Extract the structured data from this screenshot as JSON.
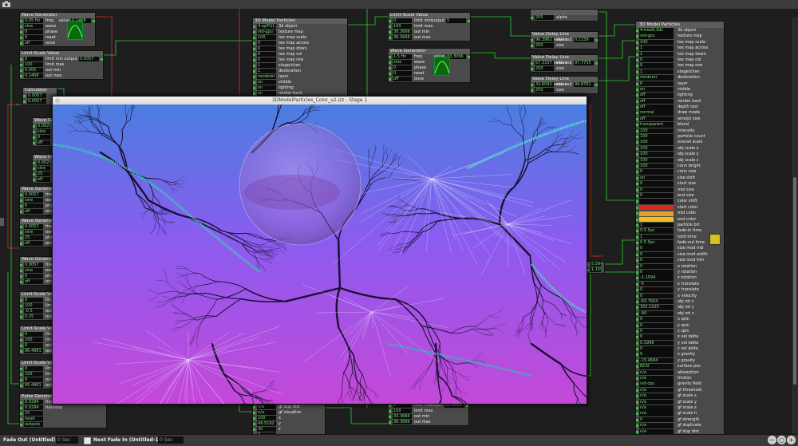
{
  "stage": {
    "title": "3DModelParticles_Color_v2.izz : Stage 1",
    "background_top": "#4a7ee0",
    "background_mid": "#8a5cf0",
    "background_bottom": "#c548d8"
  },
  "actors": {
    "wave1": {
      "title": "Wave Generator",
      "inputs": [
        "0.05 Hz",
        "sine",
        "0",
        "0",
        "off"
      ],
      "in_labels": [
        "freq",
        "wave",
        "phase",
        "reset",
        "once"
      ],
      "out_label": "value",
      "out_value": "0.1468"
    },
    "limit1": {
      "title": "Limit-Scale Value",
      "inputs": [
        "0",
        "100",
        "0.005",
        "0.1468"
      ],
      "in_labels": [
        "limit min",
        "limit max",
        "out min",
        "out max"
      ],
      "out_label": "output",
      "out_value": "0.0057"
    },
    "calc": {
      "title": "Calculator",
      "inputs": [
        "0.0057",
        "0.0057"
      ],
      "in_labels": [
        "",
        ""
      ],
      "out_label": "",
      "out_value": ""
    },
    "wave2": {
      "title": "Wave Generator",
      "inputs": [
        "0.0029",
        "sine",
        "0",
        "off"
      ],
      "in_labels": [
        "freq",
        "wave",
        "phase",
        "once"
      ]
    },
    "wave3": {
      "title": "Wave Generator",
      "inputs": [
        "0.0029",
        "sine",
        "25",
        "off"
      ],
      "in_labels": [
        "freq",
        "wave",
        "phase",
        "once"
      ]
    },
    "wave4": {
      "title": "Wave Generator",
      "inputs": [
        "0.0057",
        "sine",
        "0",
        "off"
      ],
      "in_labels": [
        "freq",
        "wave",
        "phase",
        "once"
      ]
    },
    "wave5": {
      "title": "Wave Generator",
      "inputs": [
        "0.0057",
        "sine",
        "25",
        "off"
      ],
      "in_labels": [
        "freq",
        "wave",
        "phase",
        "once"
      ]
    },
    "wave6": {
      "title": "Wave Generator",
      "inputs": [
        "0.0057",
        "sine",
        "0",
        "off"
      ],
      "in_labels": [
        "freq",
        "wave",
        "phase",
        "once"
      ]
    },
    "limit2": {
      "title": "Limit-Scale Value",
      "inputs": [
        "0",
        "100",
        "-0.5",
        "0.25"
      ],
      "in_labels": [
        "limit min",
        "limit max",
        "out min",
        "out max"
      ]
    },
    "limit3": {
      "title": "Limit-Scale Value",
      "inputs": [
        "0",
        "100",
        "0",
        "96.4961"
      ],
      "in_labels": [
        "limit min",
        "limit max",
        "out min",
        "out max"
      ]
    },
    "limit4": {
      "title": "Limit-Scale Value",
      "inputs": [
        "0",
        "100",
        "0",
        "95.4961"
      ],
      "in_labels": [
        "limit min",
        "limit max",
        "out min",
        "out max"
      ]
    },
    "pulse": {
      "title": "Pulse Generator",
      "inputs": [
        "0.0294",
        "0.0294",
        "25",
        "reset",
        "outputs"
      ],
      "in_labels": [
        "freq",
        "run/stop",
        "",
        "",
        ""
      ],
      "out_label": "trigger 1",
      "out_value": ""
    },
    "model1": {
      "title": "3D Model Particles",
      "inputs": [
        "4-upFG1.3ds",
        "vid-gpu",
        "100",
        "0",
        "0",
        "0",
        "0",
        "1",
        "1",
        "renderer",
        "on",
        "on",
        "on",
        "off"
      ],
      "in_labels": [
        "3d object",
        "texture map",
        "tex map scale",
        "tex map across",
        "tex map down",
        "tex map col",
        "tex map row",
        "stage/chan",
        "destination",
        "layer",
        "visible",
        "lighting",
        "render back",
        "depth test"
      ]
    },
    "limit_top": {
      "title": "Limit-Scale Value",
      "inputs": [
        "0",
        "100",
        "38.3666",
        "38.3666"
      ],
      "in_labels": [
        "limit min",
        "limit max",
        "out min",
        "out max"
      ],
      "out_label": "output",
      "out_value": "5"
    },
    "wave_top": {
      "title": "Wave Generator",
      "inputs": [
        "1.5 Hz",
        "sine",
        "0",
        "0",
        "off"
      ],
      "in_labels": [
        "freq",
        "wave",
        "phase",
        "reset",
        "once"
      ],
      "out_label": "value",
      "out_value": "83.3066"
    },
    "delay1": {
      "title": "Value Delay Line",
      "inputs": [
        "96.3962",
        "250"
      ],
      "in_labels": [
        "value",
        "size"
      ],
      "out_label": "value out",
      "out_value": "0.1239"
    },
    "delay2": {
      "title": "Value Delay Line",
      "inputs": [
        "57.3337",
        "250"
      ],
      "in_labels": [
        "value",
        "size"
      ],
      "out_label": "value out",
      "out_value": "97.7755"
    },
    "delay3": {
      "title": "Value Delay Line",
      "inputs": [
        "33.6091",
        "250"
      ],
      "in_labels": [
        "value",
        "size"
      ],
      "out_label": "value out",
      "out_value": "99.8761"
    },
    "alpha": {
      "title": "",
      "inputs": [
        "255"
      ],
      "in_labels": [
        "alpha"
      ]
    },
    "limit_bottom": {
      "title": "Limit-Scale Value",
      "inputs": [
        "0",
        "100",
        "33.3666",
        "38.3666"
      ],
      "in_labels": [
        "limit min",
        "limit max",
        "out min",
        "out max"
      ],
      "out_label": "output",
      "out_value": "21.6601"
    },
    "model_bottom": {
      "title": "",
      "inputs": [
        "n/a",
        "n/a",
        "n/a",
        "100",
        "49.5162",
        "30",
        "0"
      ],
      "in_labels": [
        "gf duplicate",
        "gf dup dist",
        "gf visualize",
        "x",
        "y",
        "z",
        ""
      ]
    },
    "stub_right": {
      "inputs": [
        "5.5941",
        "1.1594"
      ]
    }
  },
  "particles": {
    "title": "3D Model Particles",
    "rows": [
      [
        "4-tree9.3ds",
        "3d object"
      ],
      [
        "vid-gpu",
        "texture map"
      ],
      [
        "100",
        "tex map scale"
      ],
      [
        "1",
        "tex map across"
      ],
      [
        "1",
        "tex map down"
      ],
      [
        "0",
        "tex map col"
      ],
      [
        "0",
        "tex map row"
      ],
      [
        "1",
        "stage/chan"
      ],
      [
        "renderer",
        "destination"
      ],
      [
        "6",
        "layer"
      ],
      [
        "on",
        "visible"
      ],
      [
        "off",
        "lighting"
      ],
      [
        "off",
        "render back"
      ],
      [
        "off",
        "depth test"
      ],
      [
        "normal",
        "draw mode"
      ],
      [
        "off",
        "wire/pt size"
      ],
      [
        "transparent",
        "blend"
      ],
      [
        "100",
        "intensity"
      ],
      [
        "100",
        "particle count"
      ],
      [
        "100",
        "overall scale"
      ],
      [
        "100",
        "obj scale x"
      ],
      [
        "100",
        "obj scale y"
      ],
      [
        "100",
        "obj scale z"
      ],
      [
        "100",
        "conn bright"
      ],
      [
        "0",
        "conn size"
      ],
      [
        "on",
        "size shift"
      ],
      [
        "0",
        "start size"
      ],
      [
        "0",
        "mid size"
      ],
      [
        "0",
        "end size"
      ],
      [
        "",
        "color shift"
      ],
      [
        "",
        "start color"
      ],
      [
        "",
        "mid color"
      ],
      [
        "",
        "end color"
      ],
      [
        "1",
        "particle brt"
      ],
      [
        "0.5 Sec",
        "fade-in time"
      ],
      [
        "1",
        "hold time"
      ],
      [
        "0.5 Sec",
        "fade-out time"
      ],
      [
        "0",
        "size mod rnd"
      ],
      [
        "0",
        "size mod width"
      ],
      [
        "0",
        "size mod hvh"
      ],
      [
        "0",
        "x rotation"
      ],
      [
        "0",
        "y rotation"
      ],
      [
        "-1.1594",
        "z rotation"
      ],
      [
        "-5",
        "x translate"
      ],
      [
        "0",
        "y translate"
      ],
      [
        "0",
        "x velocity"
      ],
      [
        "-83.7604",
        "obj rot x"
      ],
      [
        "355.1025",
        "obj rot y"
      ],
      [
        "-90",
        "obj rot z"
      ],
      [
        "0",
        "x spin"
      ],
      [
        "0",
        "y spin"
      ],
      [
        "0",
        "z spin"
      ],
      [
        "0",
        "x vel delta"
      ],
      [
        "0.1996",
        "y vel delta"
      ],
      [
        "0",
        "z vel delta"
      ],
      [
        "0",
        "x gravity"
      ],
      [
        "-15.4684",
        "y gravity"
      ],
      [
        "NCN",
        "surface pos"
      ],
      [
        "n/a",
        "absorption"
      ],
      [
        "n/a",
        "friction"
      ],
      [
        "vid-cpu",
        "gravity field"
      ],
      [
        "n/a",
        "gf threshold"
      ],
      [
        "n/a",
        "gf scale x"
      ],
      [
        "n/a",
        "gf scale y"
      ],
      [
        "n/a",
        "gf scale z"
      ],
      [
        "n/a",
        "gf scale h"
      ],
      [
        "0",
        "gf strength"
      ],
      [
        "n/a",
        "gf duplicate"
      ],
      [
        "n/a",
        "gf dup dist"
      ],
      [
        "n/a",
        "gf visualize"
      ],
      [
        "-11.6334",
        "x"
      ],
      [
        "49.1767",
        "y"
      ]
    ],
    "swatch_colors": [
      "#d42b1e",
      "#e2a12a",
      "#f0c020"
    ]
  },
  "bottom": {
    "fade_out_label": "Fade Out (Untitled):",
    "fade_out_value": "0 Sec",
    "next_fade_label": "Next Fade In (Untitled-1):",
    "next_fade_value": "0 Sec"
  },
  "icons": {
    "camera": "camera-icon",
    "zoom_out": "zoom-out-icon",
    "zoom_fit": "zoom-fit-icon",
    "zoom_in": "zoom-in-icon"
  }
}
